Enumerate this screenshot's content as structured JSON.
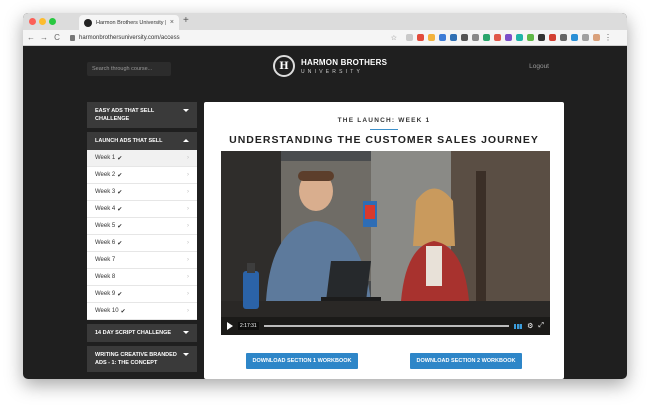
{
  "browser": {
    "tab_title": "Harmon Brothers University | ",
    "tab_close": "×",
    "new_tab": "+",
    "url": "harmonbrothersuniversity.com/access",
    "back": "←",
    "forward": "→",
    "reload": "C"
  },
  "header": {
    "search_placeholder": "Search through course...",
    "brand_mark": "H",
    "brand_name": "HARMON BROTHERS",
    "brand_sub": "UNIVERSITY",
    "logout_label": "Logout"
  },
  "sidebar": {
    "sections": [
      {
        "label": "EASY ADS THAT SELL CHALLENGE",
        "open": false
      },
      {
        "label": "LAUNCH ADS THAT SELL",
        "open": true
      },
      {
        "label": "14 DAY SCRIPT CHALLENGE",
        "open": false
      },
      {
        "label": "WRITING CREATIVE BRANDED ADS - 1: THE CONCEPT",
        "open": false
      }
    ],
    "lessons": [
      {
        "label": "Week 1",
        "done": true,
        "active": true
      },
      {
        "label": "Week 2",
        "done": true
      },
      {
        "label": "Week 3",
        "done": true
      },
      {
        "label": "Week 4",
        "done": true
      },
      {
        "label": "Week 5",
        "done": true
      },
      {
        "label": "Week 6",
        "done": true
      },
      {
        "label": "Week 7",
        "done": false
      },
      {
        "label": "Week 8",
        "done": false
      },
      {
        "label": "Week 9",
        "done": true
      },
      {
        "label": "Week 10",
        "done": true
      }
    ]
  },
  "main": {
    "kicker": "THE LAUNCH: WEEK 1",
    "title": "UNDERSTANDING THE CUSTOMER SALES JOURNEY",
    "video": {
      "timecode": "2:17:31"
    },
    "buttons": {
      "workbook1": "DOWNLOAD SECTION 1 WORKBOOK",
      "workbook2": "DOWNLOAD SECTION 2 WORKBOOK"
    }
  },
  "colors": {
    "accent": "#2e86c8",
    "page_bg": "#1f1f1f",
    "sidebar_head": "#3a3a3a"
  }
}
